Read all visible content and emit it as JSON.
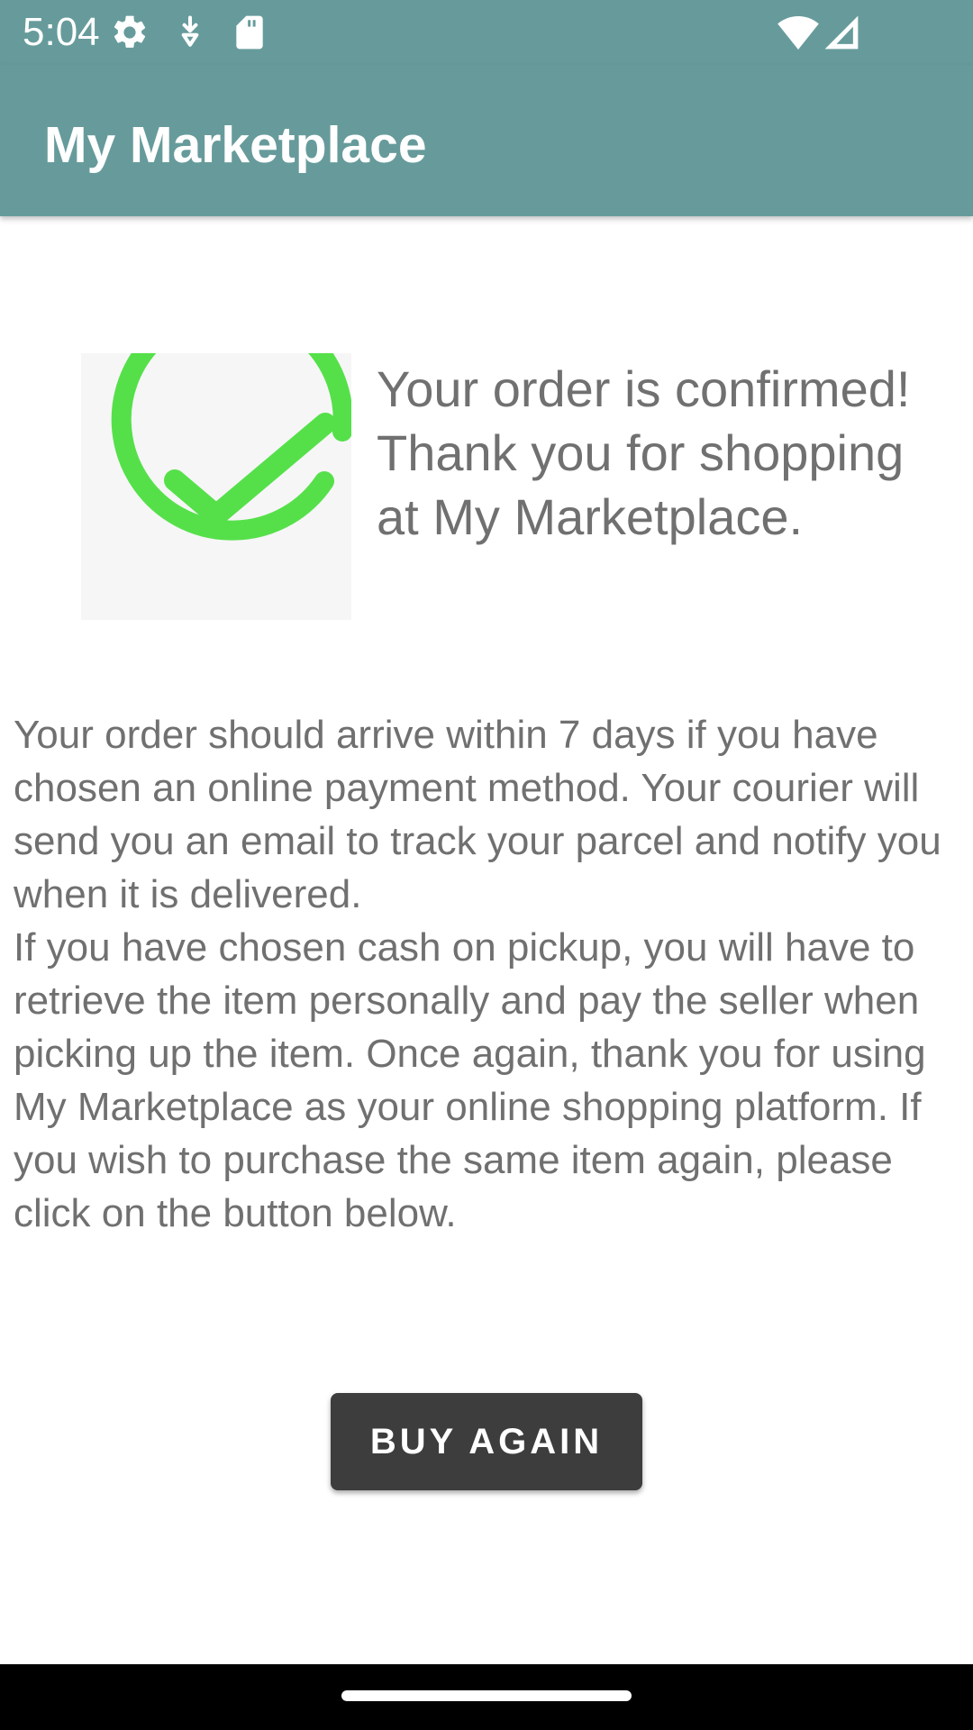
{
  "status_bar": {
    "time": "5:04",
    "icons": [
      "settings-gear",
      "download-notification",
      "sd-card",
      "wifi",
      "cell-signal"
    ]
  },
  "app_bar": {
    "title": "My Marketplace"
  },
  "confirmation": {
    "icon": "check-circle",
    "icon_color": "#55e04a",
    "message": "Your order is confirmed! Thank you for shopping at My Marketplace."
  },
  "details": {
    "paragraph_1": "Your order should arrive within 7 days if you have chosen an online payment method. Your courier will send you an email to track your parcel and notify you when it is delivered.",
    "paragraph_2": "If you have chosen cash on pickup, you will have to retrieve the item personally and pay the seller when picking up the item. Once again, thank you for using My Marketplace as your online shopping platform. If you wish to purchase the same item again, please click on the button below."
  },
  "actions": {
    "buy_again_label": "BUY AGAIN"
  },
  "colors": {
    "app_bar": "#679b9b",
    "text": "#707070",
    "button": "#3d3d3d",
    "check": "#55e04a"
  }
}
